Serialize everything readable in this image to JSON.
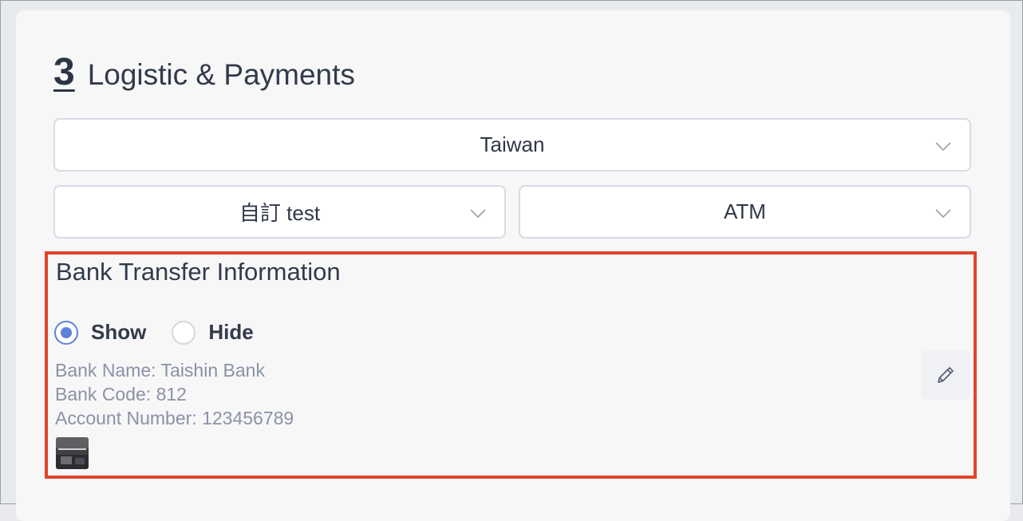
{
  "step": {
    "number": "3",
    "title": "Logistic & Payments"
  },
  "selects": {
    "country": {
      "value": "Taiwan",
      "icon": "chevron-down-icon"
    },
    "logistics": {
      "value": "自訂 test",
      "icon": "chevron-down-icon"
    },
    "payment": {
      "value": "ATM",
      "icon": "chevron-down-icon"
    }
  },
  "bank_transfer": {
    "title": "Bank Transfer Information",
    "visibility_options": [
      {
        "label": "Show",
        "selected": true
      },
      {
        "label": "Hide",
        "selected": false
      }
    ],
    "bank_name": "Bank Name: Taishin Bank",
    "bank_code": "Bank Code: 812",
    "account_number": "Account Number: 123456789",
    "edit_icon": "pencil-icon",
    "highlight_color": "#e0442b"
  },
  "colors": {
    "accent": "#5d83d6",
    "text": "#323a4b",
    "muted_text": "#8a92a6"
  }
}
